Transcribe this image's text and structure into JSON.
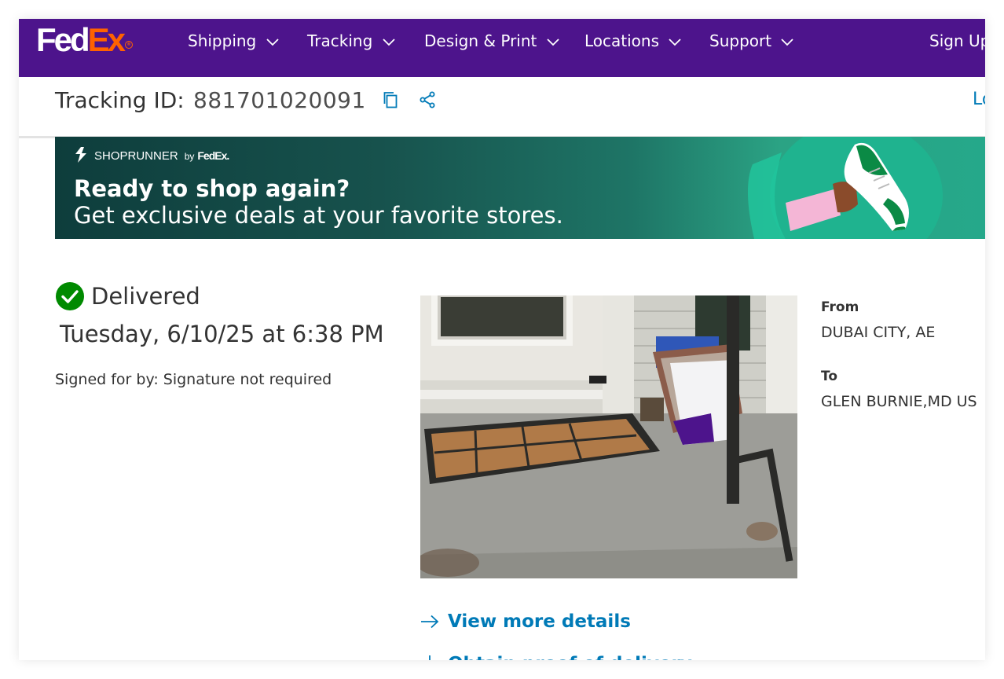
{
  "colors": {
    "brand_purple": "#4d148c",
    "brand_orange": "#ff6200",
    "link_blue": "#007ab7",
    "success_green": "#008a00",
    "banner_teal": "#1e7566"
  },
  "header": {
    "logo": {
      "fed": "Fed",
      "ex": "Ex"
    },
    "nav": [
      {
        "label": "Shipping",
        "icon": "chevron-down-icon"
      },
      {
        "label": "Tracking",
        "icon": "chevron-down-icon"
      },
      {
        "label": "Design & Print",
        "icon": "chevron-down-icon"
      },
      {
        "label": "Locations",
        "icon": "chevron-down-icon"
      },
      {
        "label": "Support",
        "icon": "chevron-down-icon"
      }
    ],
    "sign_up": "Sign Up"
  },
  "tracking": {
    "label": "Tracking ID:",
    "id": "881701020091",
    "copy_icon": "copy-icon",
    "share_icon": "share-icon",
    "right_link": "Lo"
  },
  "banner": {
    "brand": "SHOPRUNNER",
    "by": "by",
    "partner": "FedEx.",
    "title": "Ready to shop again?",
    "subtitle": "Get exclusive deals at your favorite stores."
  },
  "status": {
    "icon": "check-circle-icon",
    "label": "Delivered",
    "datetime": "Tuesday, 6/10/25 at 6:38 PM",
    "signed_for": "Signed for by: Signature not required"
  },
  "photo": {
    "alt": "Proof of delivery photo"
  },
  "shipment": {
    "from_label": "From",
    "from_value": "DUBAI CITY, AE",
    "to_label": "To",
    "to_value": "GLEN BURNIE,MD US"
  },
  "links": {
    "view_more": "View more details",
    "proof": "Obtain proof of delivery"
  }
}
